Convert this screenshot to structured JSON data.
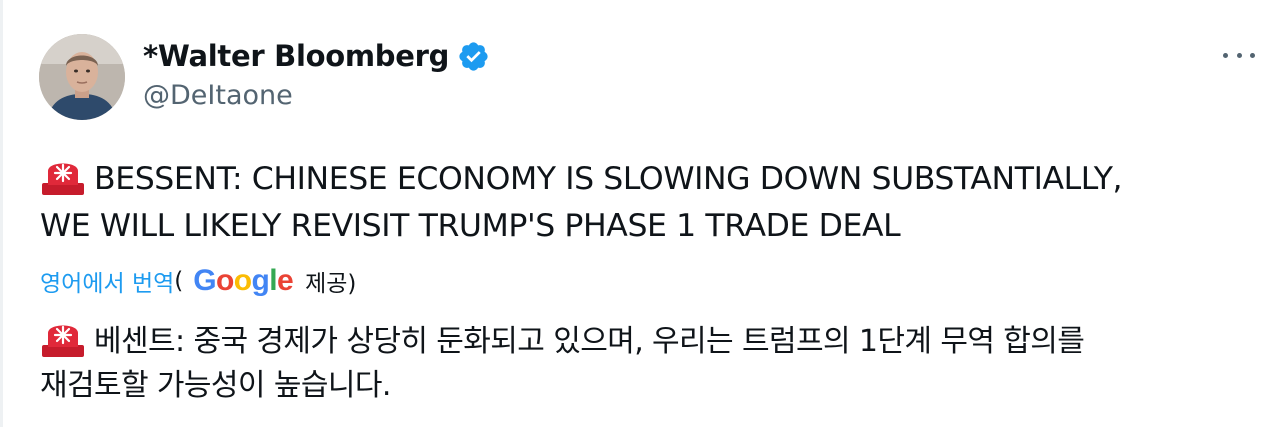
{
  "tweet": {
    "display_name": "*Walter Bloomberg",
    "handle": "@DeItaone",
    "verified": true,
    "more_icon": "more-horizontal-icon",
    "body_lines": [
      "BESSENT: CHINESE ECONOMY IS SLOWING DOWN SUBSTANTIALLY,",
      "WE WILL LIKELY REVISIT TRUMP'S PHASE 1 TRADE DEAL"
    ],
    "emoji_icon": "rotating-light-icon",
    "translation": {
      "link_label": "영어에서 번역",
      "open_paren": "(",
      "provider": "Google",
      "provided_label": "제공)",
      "lines": [
        "베센트: 중국 경제가 상당히 둔화되고 있으며, 우리는 트럼프의 1단계 무역 합의를",
        "재검토할 가능성이 높습니다."
      ]
    }
  },
  "colors": {
    "verified_blue": "#1d9bf0",
    "link_blue": "#1d9bf0",
    "secondary_text": "#536471",
    "siren_red": "#e0293a",
    "google_blue": "#4285f4",
    "google_red": "#ea4335",
    "google_yellow": "#fbbc05",
    "google_green": "#34a853"
  }
}
